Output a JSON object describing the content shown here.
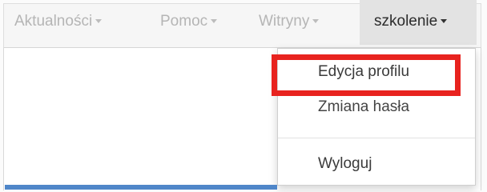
{
  "navbar": {
    "items": [
      {
        "label": "Aktualności"
      },
      {
        "label": "Pomoc"
      },
      {
        "label": "Witryny"
      },
      {
        "label": "szkolenie"
      }
    ]
  },
  "dropdown": {
    "items": [
      {
        "label": "Edycja profilu"
      },
      {
        "label": "Zmiana hasła"
      },
      {
        "label": "Wyloguj"
      }
    ]
  },
  "colors": {
    "highlight": "#e8231f",
    "accent_bar": "#4f86c9"
  }
}
